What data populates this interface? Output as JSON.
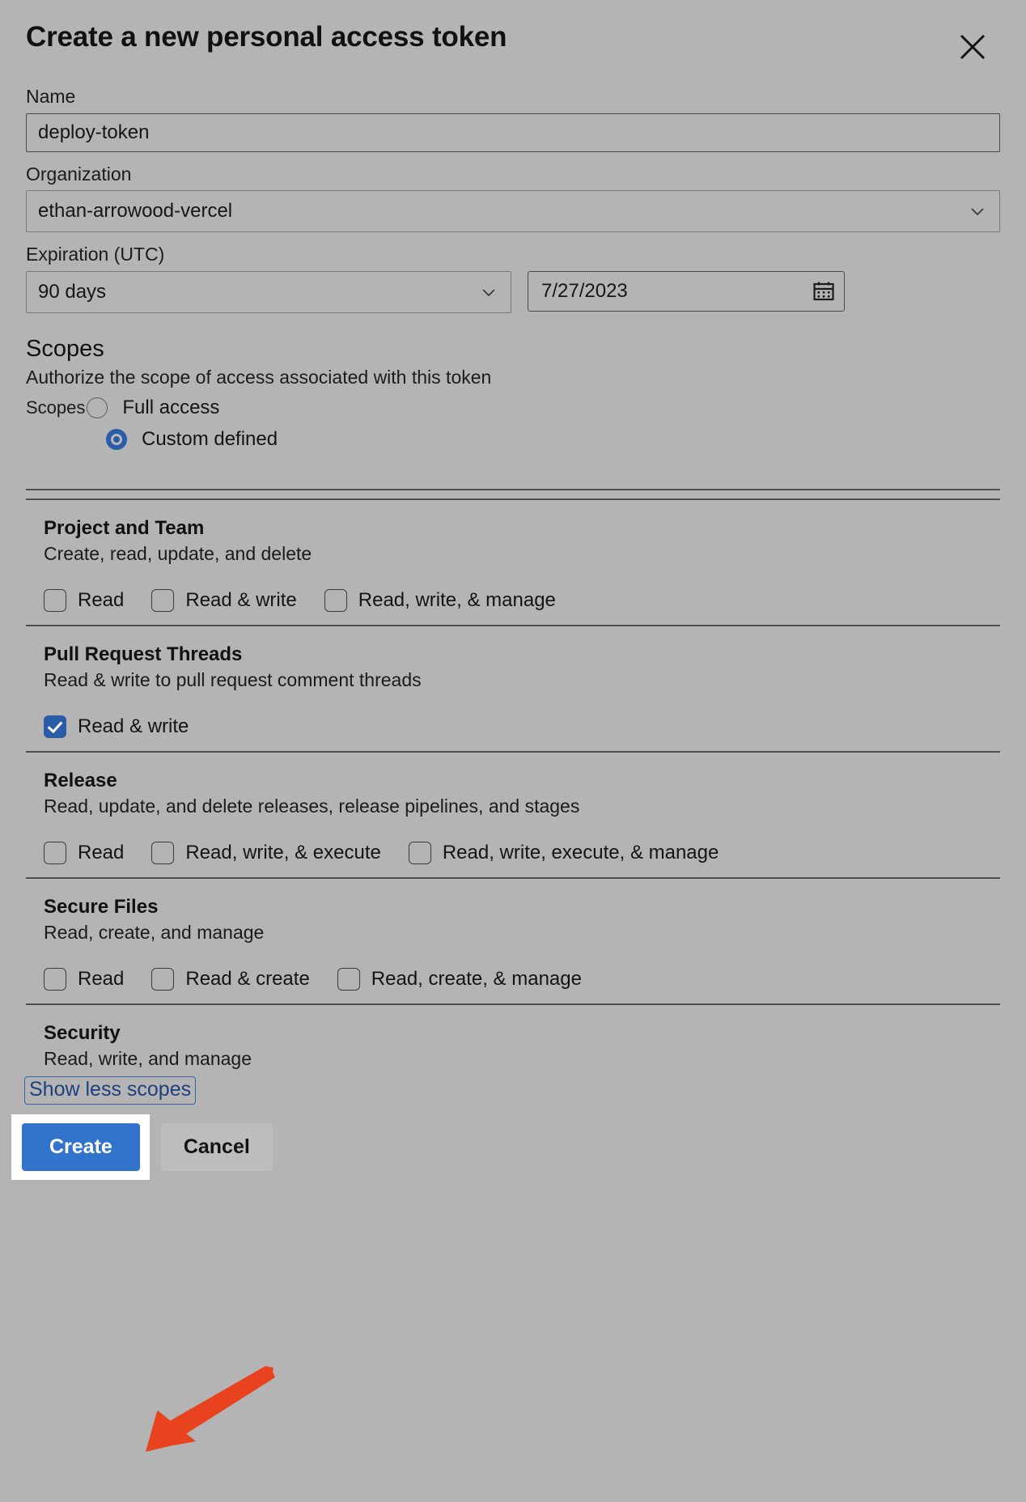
{
  "dialog": {
    "title": "Create a new personal access token",
    "close_icon": "close-icon"
  },
  "form": {
    "name": {
      "label": "Name",
      "value": "deploy-token",
      "placeholder": ""
    },
    "organization": {
      "label": "Organization",
      "value": "ethan-arrowood-vercel",
      "chevron_icon": "chevron-down-icon"
    },
    "expiration": {
      "label": "Expiration (UTC)",
      "preset_value": "90 days",
      "preset_chevron_icon": "chevron-down-icon",
      "date_value": "7/27/2023",
      "calendar_icon": "calendar-icon"
    }
  },
  "scopes": {
    "heading": "Scopes",
    "description": "Authorize the scope of access associated with this token",
    "radio_legend": "Scopes",
    "options": [
      {
        "label": "Full access",
        "checked": false
      },
      {
        "label": "Custom defined",
        "checked": true
      }
    ],
    "sections": [
      {
        "title": "Project and Team",
        "description": "Create, read, update, and delete",
        "checkboxes": [
          {
            "label": "Read",
            "checked": false
          },
          {
            "label": "Read & write",
            "checked": false
          },
          {
            "label": "Read, write, & manage",
            "checked": false
          }
        ]
      },
      {
        "title": "Pull Request Threads",
        "description": "Read & write to pull request comment threads",
        "checkboxes": [
          {
            "label": "Read & write",
            "checked": true
          }
        ]
      },
      {
        "title": "Release",
        "description": "Read, update, and delete releases, release pipelines, and stages",
        "checkboxes": [
          {
            "label": "Read",
            "checked": false
          },
          {
            "label": "Read, write, & execute",
            "checked": false
          },
          {
            "label": "Read, write, execute, & manage",
            "checked": false
          }
        ]
      },
      {
        "title": "Secure Files",
        "description": "Read, create, and manage",
        "checkboxes": [
          {
            "label": "Read",
            "checked": false
          },
          {
            "label": "Read & create",
            "checked": false
          },
          {
            "label": "Read, create, & manage",
            "checked": false
          }
        ]
      },
      {
        "title": "Security",
        "description": "Read, write, and manage",
        "checkboxes": []
      }
    ],
    "show_less_label": "Show less scopes"
  },
  "footer": {
    "create_label": "Create",
    "cancel_label": "Cancel"
  },
  "annotation": {
    "arrow_color": "#E8421E",
    "highlight_color": "#FFFFFF",
    "target": "Create"
  },
  "colors": {
    "background": "#B4B4B4",
    "accent_blue": "#3273CC",
    "control_blue": "#2A5CA8",
    "link_blue": "#1F3F7D",
    "border_dark": "#4A4A4A",
    "border_light": "#7B7B7B"
  }
}
